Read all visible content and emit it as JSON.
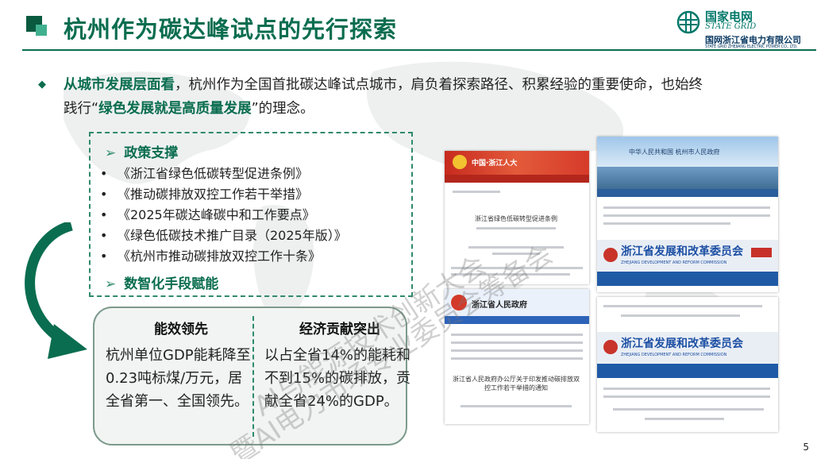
{
  "header": {
    "title": "杭州作为碳达峰试点的先行探索",
    "logo_cn": "国家电网",
    "logo_en": "STATE GRID",
    "company": "国网浙江省电力有限公司",
    "company_en": "STATE GRID ZHEJIANG ELECTRIC POWER CO., LTD."
  },
  "intro": {
    "highlight1": "从城市发展层面看",
    "text1": "，杭州作为全国首批碳达峰试点城市，肩负着探索路径、积累经验的重要使命，也始终",
    "text2a": "践行“",
    "highlight2": "绿色发展就是高质量发展",
    "text2b": "”的理念。"
  },
  "policy": {
    "heading": "政策支撑",
    "items": [
      "《浙江省绿色低碳转型促进条例》",
      "《推动碳排放双控工作若干举措》",
      "《2025年碳达峰碳中和工作要点》",
      "《绿色低碳技术推广目录（2025年版）》",
      "《杭州市推动碳排放双控工作十条》"
    ],
    "digital_heading": "数智化手段赋能"
  },
  "stats": [
    {
      "title": "能效领先",
      "text": "杭州单位GDP能耗降至0.23吨标煤/万元，居全省第一、全国领先。"
    },
    {
      "title": "经济贡献突出",
      "text": "以占全省14%的能耗和不到15%的碳排放，贡献全省24%的GDP。"
    }
  ],
  "docs": {
    "d1_site": "中国·浙江人大",
    "d1_title": "浙江省绿色低碳转型促进条例",
    "d2_site": "浙江省人民政府",
    "d2_title": "浙江省人民政府办公厅关于印发推动碳排放双控工作若干举措的通知",
    "d3_site": "中华人民共和国 杭州市人民政府",
    "d3_band": "浙江省发展和改革委员会",
    "d3_band_en": "ZHEJIANG DEVELOPMENT AND REFORM COMMISSION",
    "d4_band": "浙江省发展和改革委员会",
    "d4_band_en": "ZHEJIANG DEVELOPMENT AND REFORM COMMISSION"
  },
  "watermark": {
    "line1": "AI与能源技术创新大会",
    "line2": "暨AI电力市场专业委员会筹备会"
  },
  "page_number": "5",
  "colors": {
    "brand_green": "#0a6d4f",
    "accent_green": "#2f8a6b"
  }
}
